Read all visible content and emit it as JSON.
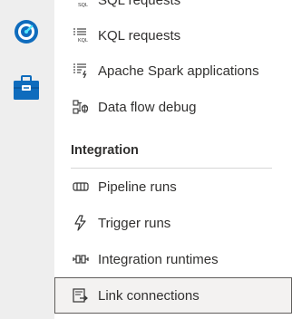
{
  "nav_rail": {
    "items": [
      {
        "name": "monitor",
        "icon": "gauge-icon"
      },
      {
        "name": "manage",
        "icon": "toolbox-icon"
      }
    ]
  },
  "menu": {
    "top_items": [
      {
        "label": "SQL requests",
        "icon": "sql-list-icon"
      },
      {
        "label": "KQL requests",
        "icon": "kql-list-icon"
      },
      {
        "label": "Apache Spark applications",
        "icon": "spark-list-icon"
      },
      {
        "label": "Data flow debug",
        "icon": "dataflow-debug-icon"
      }
    ],
    "integration_section": {
      "title": "Integration",
      "items": [
        {
          "label": "Pipeline runs",
          "icon": "pipeline-icon"
        },
        {
          "label": "Trigger runs",
          "icon": "trigger-icon"
        },
        {
          "label": "Integration runtimes",
          "icon": "runtime-icon"
        },
        {
          "label": "Link connections",
          "icon": "link-connection-icon",
          "selected": true
        }
      ]
    }
  },
  "colors": {
    "accent": "#0078d4",
    "rail_bg": "#eeeeee",
    "selected_bg": "#f3f2f1"
  }
}
